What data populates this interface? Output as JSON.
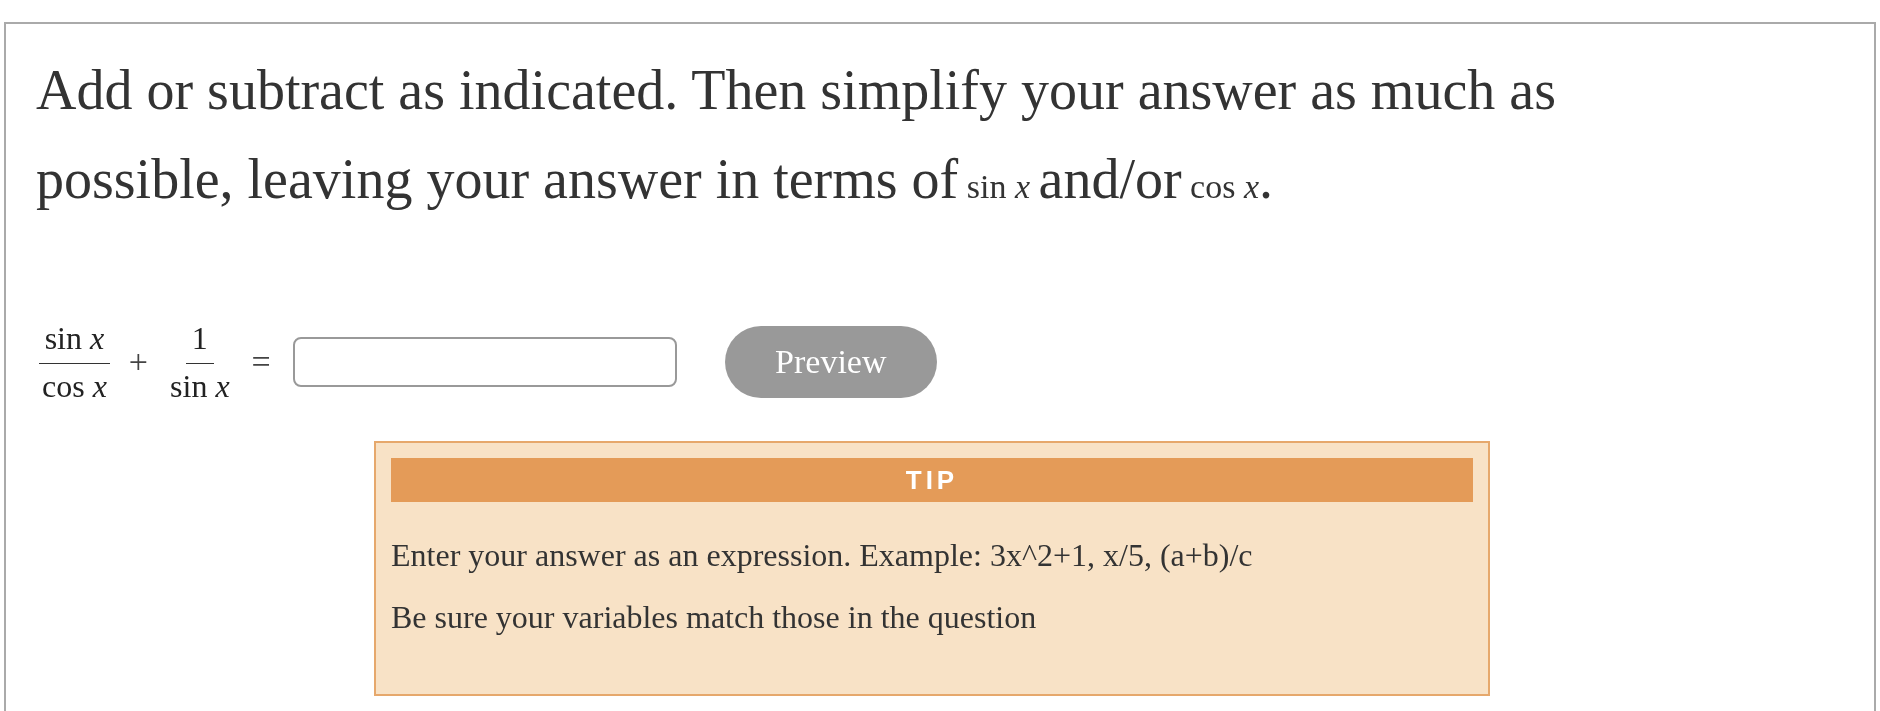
{
  "question": [
    {
      "kind": "text",
      "text": "Add or subtract as indicated. Then simplify your answer as much as possible, leaving your answer in terms of"
    },
    {
      "kind": "math",
      "text": "sin *x*"
    },
    {
      "kind": "text",
      "text": "and/or"
    },
    {
      "kind": "math",
      "text": "cos *x*"
    },
    {
      "kind": "text",
      "text": "."
    }
  ],
  "equation": [
    {
      "kind": "fraction",
      "numerator": "sin *x*",
      "denominator": "cos *x*"
    },
    {
      "kind": "operator",
      "text": "+"
    },
    {
      "kind": "fraction",
      "numerator": "1",
      "denominator": "sin *x*"
    },
    {
      "kind": "operator",
      "text": "="
    }
  ],
  "preview_button": {
    "label": "Preview"
  },
  "tip": {
    "title": "TIP",
    "lines": [
      "Enter your answer as an expression. Example: 3x^2+1, x/5, (a+b)/c",
      "Be sure your variables match those in the question"
    ]
  }
}
